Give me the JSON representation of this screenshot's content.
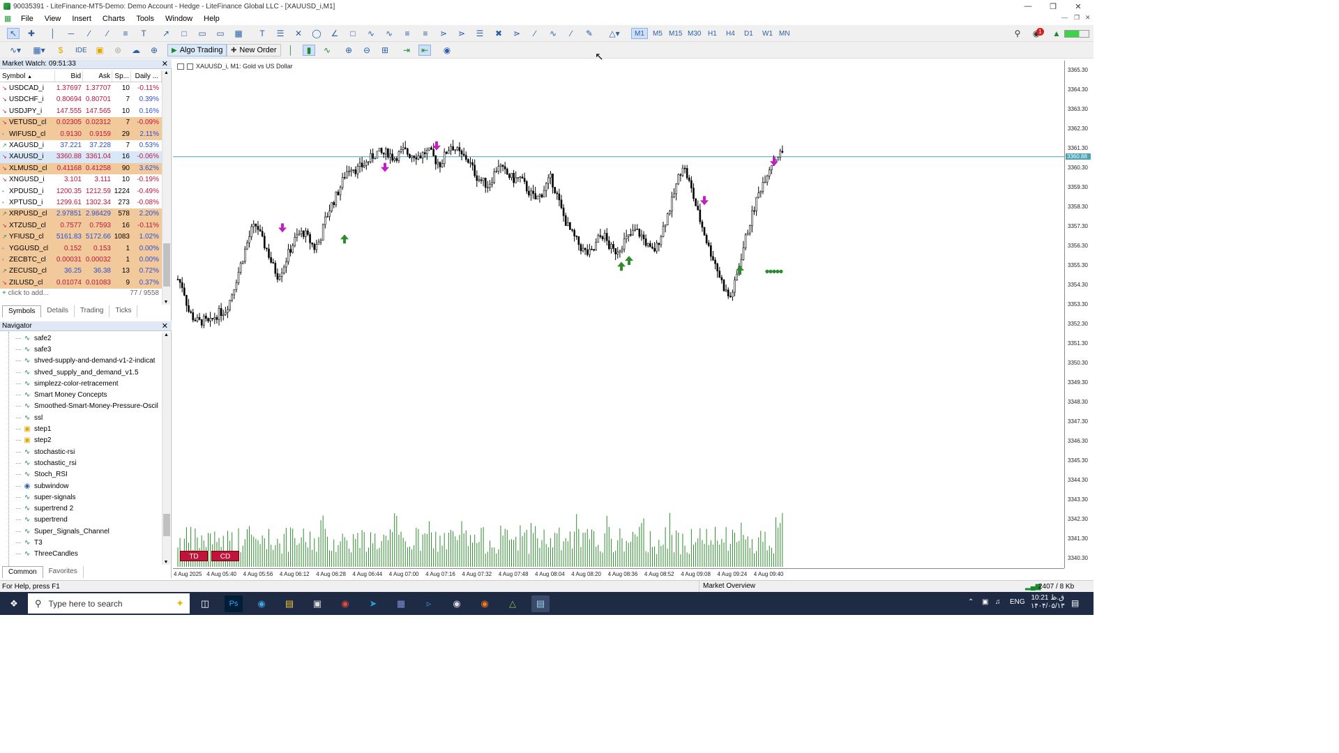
{
  "window": {
    "title": "90035391 - LiteFinance-MT5-Demo: Demo Account - Hedge - LiteFinance Global LLC - [XAUUSD_i,M1]"
  },
  "menu": [
    "File",
    "View",
    "Insert",
    "Charts",
    "Tools",
    "Window",
    "Help"
  ],
  "toolbar": {
    "timeframes": [
      "M1",
      "M5",
      "M15",
      "M30",
      "H1",
      "H4",
      "D1",
      "W1",
      "MN"
    ],
    "selected_timeframe": "M1",
    "algo_trading": "Algo Trading",
    "new_order": "New Order",
    "ide": "IDE",
    "notification_count": "1"
  },
  "market_watch": {
    "title": "Market Watch: 09:51:33",
    "columns": [
      "Symbol",
      "Bid",
      "Ask",
      "Sp...",
      "Daily ..."
    ],
    "rows": [
      {
        "symbol": "USDCAD_i",
        "bid": "1.37697",
        "ask": "1.37707",
        "spread": "10",
        "daily": "-0.11%",
        "dir": "down",
        "hl": "none"
      },
      {
        "symbol": "USDCHF_i",
        "bid": "0.80694",
        "ask": "0.80701",
        "spread": "7",
        "daily": "0.39%",
        "dir": "down",
        "hl": "none"
      },
      {
        "symbol": "USDJPY_i",
        "bid": "147.555",
        "ask": "147.565",
        "spread": "10",
        "daily": "0.16%",
        "dir": "down",
        "hl": "none"
      },
      {
        "symbol": "VETUSD_cl",
        "bid": "0.02305",
        "ask": "0.02312",
        "spread": "7",
        "daily": "-0.09%",
        "dir": "down",
        "hl": "orange"
      },
      {
        "symbol": "WIFUSD_cl",
        "bid": "0.9130",
        "ask": "0.9159",
        "spread": "29",
        "daily": "2.11%",
        "dir": "dot",
        "hl": "orange"
      },
      {
        "symbol": "XAGUSD_i",
        "bid": "37.221",
        "ask": "37.228",
        "spread": "7",
        "daily": "0.53%",
        "dir": "up",
        "hl": "none"
      },
      {
        "symbol": "XAUUSD_i",
        "bid": "3360.88",
        "ask": "3361.04",
        "spread": "16",
        "daily": "-0.06%",
        "dir": "down",
        "hl": "blue"
      },
      {
        "symbol": "XLMUSD_cl",
        "bid": "0.41168",
        "ask": "0.41258",
        "spread": "90",
        "daily": "3.62%",
        "dir": "down",
        "hl": "orange"
      },
      {
        "symbol": "XNGUSD_i",
        "bid": "3.101",
        "ask": "3.111",
        "spread": "10",
        "daily": "-0.19%",
        "dir": "down",
        "hl": "none"
      },
      {
        "symbol": "XPDUSD_i",
        "bid": "1200.35",
        "ask": "1212.59",
        "spread": "1224",
        "daily": "-0.49%",
        "dir": "dot",
        "hl": "none"
      },
      {
        "symbol": "XPTUSD_i",
        "bid": "1299.61",
        "ask": "1302.34",
        "spread": "273",
        "daily": "-0.08%",
        "dir": "dot",
        "hl": "none"
      },
      {
        "symbol": "XRPUSD_cl",
        "bid": "2.97851",
        "ask": "2.98429",
        "spread": "578",
        "daily": "2.20%",
        "dir": "up",
        "hl": "orange"
      },
      {
        "symbol": "XTZUSD_cl",
        "bid": "0.7577",
        "ask": "0.7593",
        "spread": "16",
        "daily": "-0.11%",
        "dir": "down",
        "hl": "orange"
      },
      {
        "symbol": "YFIUSD_cl",
        "bid": "5161.83",
        "ask": "5172.66",
        "spread": "1083",
        "daily": "1.02%",
        "dir": "up",
        "hl": "orange"
      },
      {
        "symbol": "YGGUSD_cl",
        "bid": "0.152",
        "ask": "0.153",
        "spread": "1",
        "daily": "0.00%",
        "dir": "dot",
        "hl": "orange"
      },
      {
        "symbol": "ZECBTC_cl",
        "bid": "0.00031",
        "ask": "0.00032",
        "spread": "1",
        "daily": "0.00%",
        "dir": "dot",
        "hl": "orange"
      },
      {
        "symbol": "ZECUSD_cl",
        "bid": "36.25",
        "ask": "36.38",
        "spread": "13",
        "daily": "0.72%",
        "dir": "up",
        "hl": "orange"
      },
      {
        "symbol": "ZILUSD_cl",
        "bid": "0.01074",
        "ask": "0.01083",
        "spread": "9",
        "daily": "0.37%",
        "dir": "down",
        "hl": "orange"
      }
    ],
    "add_label": "click to add...",
    "count": "77 / 9558",
    "tabs": [
      "Symbols",
      "Details",
      "Trading",
      "Ticks"
    ]
  },
  "navigator": {
    "title": "Navigator",
    "items": [
      {
        "name": "safe2",
        "icon": "ind"
      },
      {
        "name": "safe3",
        "icon": "ind"
      },
      {
        "name": "shved-supply-and-demand-v1-2-indicat",
        "icon": "ind"
      },
      {
        "name": "shved_supply_and_demand_v1.5",
        "icon": "ind"
      },
      {
        "name": "simplezz-color-retracement",
        "icon": "ind"
      },
      {
        "name": "Smart Money Concepts",
        "icon": "ind"
      },
      {
        "name": "Smoothed-Smart-Money-Pressure-Oscil",
        "icon": "ind"
      },
      {
        "name": "ssl",
        "icon": "ind"
      },
      {
        "name": "step1",
        "icon": "folder"
      },
      {
        "name": "step2",
        "icon": "folder"
      },
      {
        "name": "stochastic-rsi",
        "icon": "ind"
      },
      {
        "name": "stochastic_rsi",
        "icon": "ind"
      },
      {
        "name": "Stoch_RSI",
        "icon": "ind"
      },
      {
        "name": "subwindow",
        "icon": "sub"
      },
      {
        "name": "super-signals",
        "icon": "ind"
      },
      {
        "name": "supertrend 2",
        "icon": "ind"
      },
      {
        "name": "supertrend",
        "icon": "ind"
      },
      {
        "name": "Super_Signals_Channel",
        "icon": "ind"
      },
      {
        "name": "T3",
        "icon": "ind"
      },
      {
        "name": "ThreeCandles",
        "icon": "ind"
      }
    ],
    "tabs": [
      "Common",
      "Favorites"
    ]
  },
  "chart": {
    "caption": "XAUUSD_i, M1:  Gold vs US Dollar",
    "current_price": "3360.88",
    "price_labels": [
      "3365.30",
      "3364.30",
      "3363.30",
      "3362.30",
      "3361.30",
      "3360.30",
      "3359.30",
      "3358.30",
      "3357.30",
      "3356.30",
      "3355.30",
      "3354.30",
      "3353.30",
      "3352.30",
      "3351.30",
      "3350.30",
      "3349.30",
      "3348.30",
      "3347.30",
      "3346.30",
      "3345.30",
      "3344.30",
      "3343.30",
      "3342.30",
      "3341.30",
      "3340.30"
    ],
    "time_labels": [
      "4 Aug 2025",
      "4 Aug 05:40",
      "4 Aug 05:56",
      "4 Aug 06:12",
      "4 Aug 06:28",
      "4 Aug 06:44",
      "4 Aug 07:00",
      "4 Aug 07:16",
      "4 Aug 07:32",
      "4 Aug 07:48",
      "4 Aug 08:04",
      "4 Aug 08:20",
      "4 Aug 08:36",
      "4 Aug 08:52",
      "4 Aug 09:08",
      "4 Aug 09:24",
      "4 Aug 09:40"
    ],
    "buttons": [
      "TD",
      "CD"
    ],
    "colors": {
      "candle": "#000000",
      "volume": "#2e8b2e",
      "buy_arrow": "#2e8b2e",
      "sell_arrow": "#c020c0",
      "price_line": "#4aa3b5"
    }
  },
  "chart_data": {
    "type": "candlestick",
    "symbol": "XAUUSD_i",
    "timeframe": "M1",
    "y_range": [
      3339.8,
      3365.8
    ],
    "close_path": [
      3354.6,
      3354.2,
      3353.0,
      3352.6,
      3352.4,
      3352.5,
      3352.3,
      3352.7,
      3352.9,
      3353.0,
      3353.6,
      3354.5,
      3355.4,
      3356.3,
      3357.1,
      3357.4,
      3356.6,
      3356.1,
      3355.3,
      3354.8,
      3355.2,
      3355.9,
      3356.5,
      3356.9,
      3357.0,
      3356.6,
      3356.2,
      3356.6,
      3357.6,
      3358.3,
      3358.8,
      3359.4,
      3360.1,
      3360.4,
      3360.2,
      3360.4,
      3360.6,
      3360.9,
      3361.1,
      3361.0,
      3361.1,
      3360.8,
      3361.0,
      3361.2,
      3361.0,
      3361.0,
      3360.9,
      3361.1,
      3361.1,
      3360.7,
      3360.5,
      3361.1,
      3361.5,
      3361.2,
      3360.9,
      3360.8,
      3360.3,
      3359.8,
      3359.6,
      3359.4,
      3359.9,
      3360.5,
      3360.1,
      3359.9,
      3359.7,
      3359.8,
      3359.4,
      3359.0,
      3358.7,
      3358.9,
      3359.4,
      3359.8,
      3359.0,
      3358.1,
      3357.4,
      3356.9,
      3356.5,
      3356.1,
      3355.9,
      3356.0,
      3356.7,
      3356.9,
      3356.3,
      3356.0,
      3356.2,
      3356.6,
      3356.8,
      3357.1,
      3356.9,
      3356.5,
      3356.0,
      3356.2,
      3357.0,
      3357.8,
      3358.6,
      3359.6,
      3360.5,
      3359.8,
      3358.9,
      3357.9,
      3357.1,
      3356.2,
      3355.6,
      3354.8,
      3354.1,
      3353.6,
      3354.4,
      3355.6,
      3356.7,
      3357.7,
      3358.6,
      3359.4,
      3360.0,
      3360.6,
      3360.9,
      3361.1
    ]
  }
}
